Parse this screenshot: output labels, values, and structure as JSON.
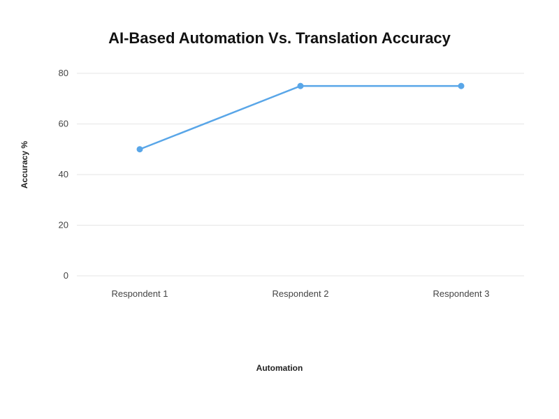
{
  "chart_data": {
    "type": "line",
    "title": "AI-Based Automation Vs. Translation Accuracy",
    "xlabel": "Automation",
    "ylabel": "Accuracy %",
    "ylim": [
      0,
      80
    ],
    "y_ticks": [
      0,
      20,
      40,
      60,
      80
    ],
    "categories": [
      "Respondent 1",
      "Respondent 2",
      "Respondent 3"
    ],
    "values": [
      50,
      75,
      75
    ],
    "colors": {
      "line": "#59a6e8",
      "grid": "#e5e5e5",
      "text": "#444444"
    }
  }
}
